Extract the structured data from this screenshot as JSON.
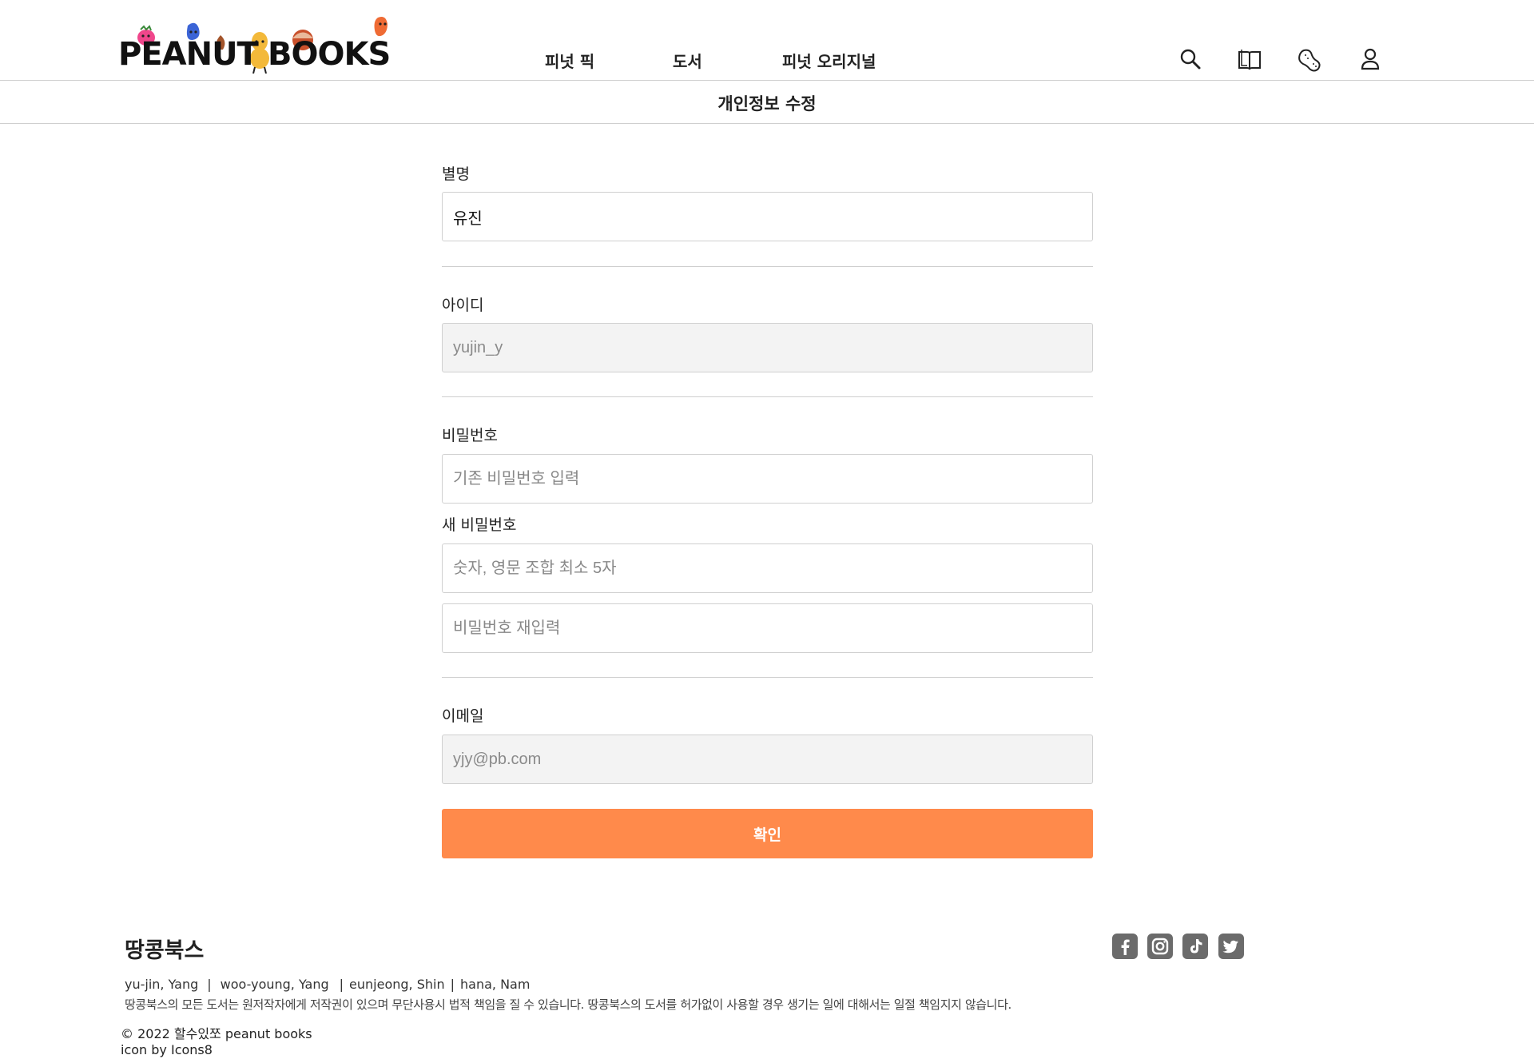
{
  "header": {
    "logo": {
      "text_left": "PEANUT",
      "text_right": "BOOKS"
    },
    "nav": [
      {
        "label": "피넛 픽"
      },
      {
        "label": "도서"
      },
      {
        "label": "피넛 오리지널"
      }
    ],
    "icons": [
      "search-icon",
      "book-icon",
      "peanut-icon",
      "user-icon"
    ]
  },
  "page": {
    "title": "개인정보 수정"
  },
  "form": {
    "nickname": {
      "label": "별명",
      "value": "유진"
    },
    "userid": {
      "label": "아이디",
      "value": "yujin_y"
    },
    "password": {
      "label": "비밀번호",
      "current_placeholder": "기존 비밀번호 입력",
      "new_label": "새 비밀번호",
      "new_placeholder": "숫자, 영문 조합 최소 5자",
      "confirm_placeholder": "비밀번호 재입력"
    },
    "email": {
      "label": "이메일",
      "value": "yjy@pb.com"
    },
    "submit_label": "확인"
  },
  "footer": {
    "brand": "땅콩북스",
    "members": [
      "yu-jin, Yang",
      "woo-young, Yang",
      "eunjeong, Shin",
      "hana, Nam"
    ],
    "notice": "땅콩북스의 모든 도서는 원저작자에게 저작권이 있으며 무단사용시 법적 책임을 질 수 있습니다. 땅콩북스의 도서를 허가없이 사용할 경우 생기는 일에 대해서는 일절 책임지지 않습니다.",
    "copyright": "© 2022 할수있쪼 peanut books",
    "credit": "icon by Icons8",
    "social": [
      "facebook-icon",
      "instagram-icon",
      "tiktok-icon",
      "twitter-icon"
    ]
  },
  "colors": {
    "accent": "#ff8a4b",
    "readonly_bg": "#f3f3f3",
    "border": "#d0d0d0",
    "social_icon": "#6b6b6b"
  }
}
